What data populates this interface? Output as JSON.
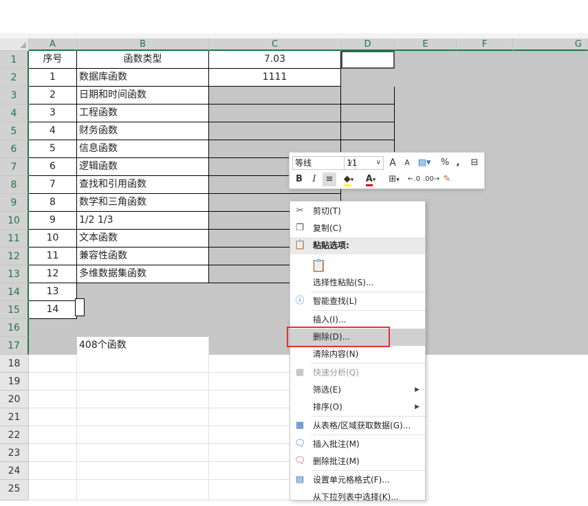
{
  "columns": [
    "A",
    "B",
    "C",
    "D",
    "E",
    "F",
    "G"
  ],
  "rows": [
    "1",
    "2",
    "3",
    "4",
    "5",
    "6",
    "7",
    "8",
    "9",
    "10",
    "11",
    "12",
    "13",
    "14",
    "15",
    "16",
    "17",
    "18",
    "19",
    "20",
    "21",
    "22",
    "23",
    "24",
    "25"
  ],
  "cells": {
    "A1": "序号",
    "B1": "函数类型",
    "C1": "7.03",
    "A2": "1",
    "B2": "数据库函数",
    "C2": "1111",
    "A3": "2",
    "B3": "日期和时间函数",
    "A4": "3",
    "B4": "工程函数",
    "A5": "4",
    "B5": "财务函数",
    "A6": "5",
    "B6": "信息函数",
    "A7": "6",
    "B7": "逻辑函数",
    "A8": "7",
    "B8": "查找和引用函数",
    "A9": "8",
    "B9": "数学和三角函数",
    "A10": "9",
    "B10": "1/2 1/3",
    "A11": "10",
    "B11": "文本函数",
    "A12": "11",
    "B12": "兼容性函数",
    "A13": "12",
    "B13": "多维数据集函数",
    "A14": "13",
    "A15": "14",
    "B17": "408个函数"
  },
  "mini_toolbar": {
    "font": "等线",
    "size": "11",
    "bold": "B",
    "italic": "I",
    "percent": "%",
    "comma": ",",
    "grow": "A",
    "shrink": "A"
  },
  "context_menu": [
    {
      "label": "剪切(T)",
      "icon": "scissors-icon",
      "disabled": false
    },
    {
      "label": "复制(C)",
      "icon": "copy-icon",
      "disabled": false
    },
    {
      "label": "粘贴选项:",
      "icon": "paste-icon",
      "header": true
    },
    {
      "label": "",
      "icon": "clipboard-icon"
    },
    {
      "label": "选择性粘贴(S)...",
      "icon": ""
    },
    {
      "label": "智能查找(L)",
      "icon": "info-search-icon"
    },
    {
      "label": "插入(I)...",
      "icon": ""
    },
    {
      "label": "删除(D)...",
      "icon": "",
      "hover": true
    },
    {
      "label": "清除内容(N)",
      "icon": ""
    },
    {
      "label": "快速分析(Q)",
      "icon": "quick-analysis-icon",
      "disabled": true
    },
    {
      "label": "筛选(E)",
      "icon": "",
      "submenu": true
    },
    {
      "label": "排序(O)",
      "icon": "",
      "submenu": true
    },
    {
      "label": "从表格/区域获取数据(G)...",
      "icon": "table-icon"
    },
    {
      "label": "插入批注(M)",
      "icon": "insert-comment-icon"
    },
    {
      "label": "删除批注(M)",
      "icon": "delete-comment-icon"
    },
    {
      "label": "设置单元格格式(F)...",
      "icon": "format-cells-icon"
    },
    {
      "label": "从下拉列表中选择(K)...",
      "icon": ""
    }
  ]
}
